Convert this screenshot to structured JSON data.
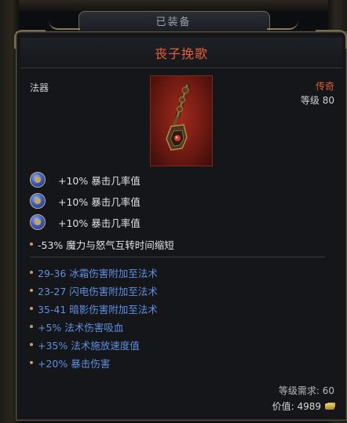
{
  "header": {
    "equipped_label": "已装备"
  },
  "item": {
    "name": "丧子挽歌",
    "type": "法器",
    "rarity": "传奇",
    "level": "等级 80",
    "image_icon": "mace-icon"
  },
  "gem_stats": [
    {
      "icon": "sapphire-gem-icon",
      "text": "+10% 暴击几率值"
    },
    {
      "icon": "sapphire-gem-icon",
      "text": "+10% 暴击几率值"
    },
    {
      "icon": "sapphire-gem-icon",
      "text": "+10% 暴击几率值"
    }
  ],
  "base_stats": [
    "-53% 魔力与怒气互转时间缩短"
  ],
  "affix_stats": [
    "29-36 冰霜伤害附加至法术",
    "23-27 闪电伤害附加至法术",
    "35-41 暗影伤害附加至法术",
    "+5% 法术伤害吸血",
    "+35% 法术施放速度值",
    "+20% 暴击伤害"
  ],
  "footer": {
    "requirement": "等级需求: 60",
    "price": "价值: 4989"
  },
  "colors": {
    "legendary": "#e0603a",
    "affix_blue": "#5f8fe0",
    "panel_bg": "#141619"
  }
}
